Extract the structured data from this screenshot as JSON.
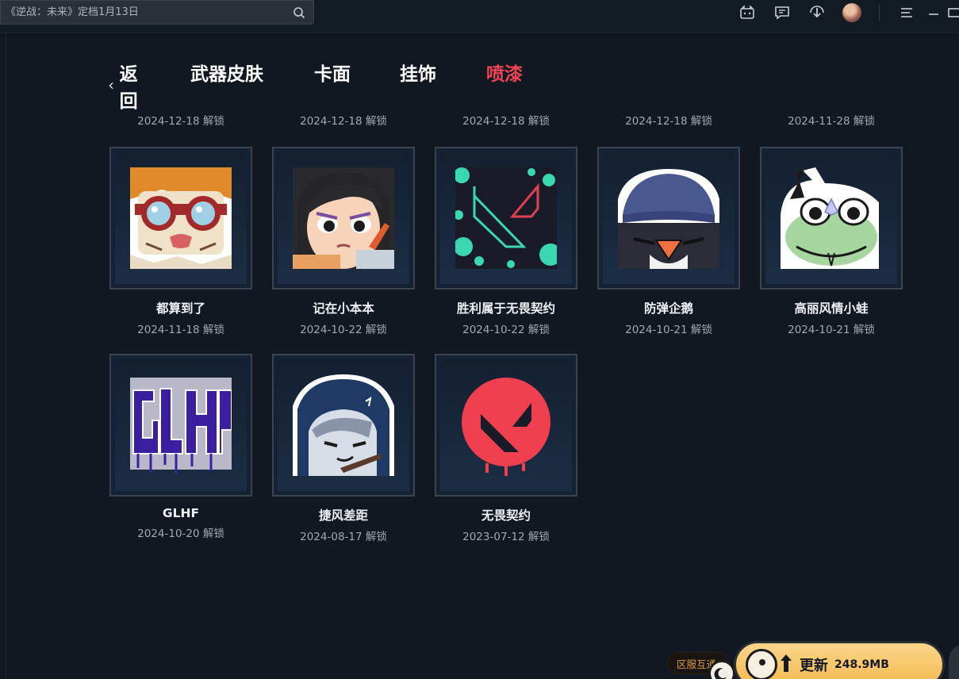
{
  "search": {
    "placeholder": "《逆战：未来》定档1月13日"
  },
  "topbar": {
    "icons": [
      "chat-bot-icon",
      "message-icon",
      "download-icon",
      "avatar",
      "menu-icon",
      "minimize-icon",
      "maximize-icon"
    ]
  },
  "nav": {
    "back_label": "返回",
    "tabs": [
      {
        "label": "武器皮肤",
        "active": false
      },
      {
        "label": "卡面",
        "active": false
      },
      {
        "label": "挂饰",
        "active": false
      },
      {
        "label": "喷漆",
        "active": true
      }
    ]
  },
  "colors": {
    "active_tab": "#ef4456",
    "update_button": "#f5b94f",
    "region_text": "#d99a45"
  },
  "cutoff_row": [
    {
      "date": "2024-12-18 解锁"
    },
    {
      "date": "2024-12-18 解锁"
    },
    {
      "date": "2024-12-18 解锁"
    },
    {
      "date": "2024-12-18 解锁"
    },
    {
      "date": "2024-11-28 解锁"
    }
  ],
  "sprays": [
    {
      "name": "都算到了",
      "date": "2024-11-18 解锁",
      "icon": "goggles-character-icon"
    },
    {
      "name": "记在小本本",
      "date": "2024-10-22 解锁",
      "icon": "notebook-girl-icon"
    },
    {
      "name": "胜利属于无畏契约",
      "date": "2024-10-22 解锁",
      "icon": "valorant-logo-splatter-icon"
    },
    {
      "name": "防弹企鹅",
      "date": "2024-10-21 解锁",
      "icon": "penguin-icon"
    },
    {
      "name": "高丽风情小蛙",
      "date": "2024-10-21 解锁",
      "icon": "frog-icon"
    },
    {
      "name": "GLHF",
      "date": "2024-10-20 解锁",
      "icon": "glhf-graffiti-icon"
    },
    {
      "name": "捷风差距",
      "date": "2024-08-17 解锁",
      "icon": "jett-hood-icon"
    },
    {
      "name": "无畏契约",
      "date": "2023-07-12 解锁",
      "icon": "valorant-red-logo-icon"
    }
  ],
  "footer": {
    "region_label": "区服互通",
    "update_label": "更新",
    "update_size": "248.9MB"
  }
}
